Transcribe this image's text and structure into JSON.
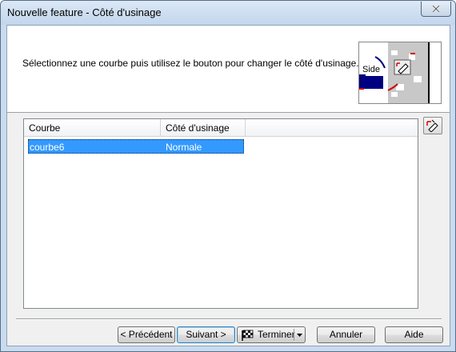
{
  "window": {
    "title": "Nouvelle feature - Côté d'usinage"
  },
  "header": {
    "instruction": "Sélectionnez une courbe puis utilisez le bouton pour changer le côté d'usinage.",
    "thumbnail_label": "Side"
  },
  "table": {
    "columns": [
      "Courbe",
      "Côté d'usinage"
    ],
    "rows": [
      {
        "courbe": "courbe6",
        "cote": "Normale",
        "selected": true
      }
    ]
  },
  "buttons": {
    "prev": "< Précédent",
    "next": "Suivant >",
    "finish": "Terminer",
    "cancel": "Annuler",
    "help": "Aide"
  },
  "colors": {
    "selection": "#3399ff",
    "titlebar": "#c9dcef",
    "accent_blue": "#000080"
  },
  "icons": {
    "side_change": "change-side-icon",
    "finish": "checkered-flag-icon",
    "close": "close-icon"
  }
}
